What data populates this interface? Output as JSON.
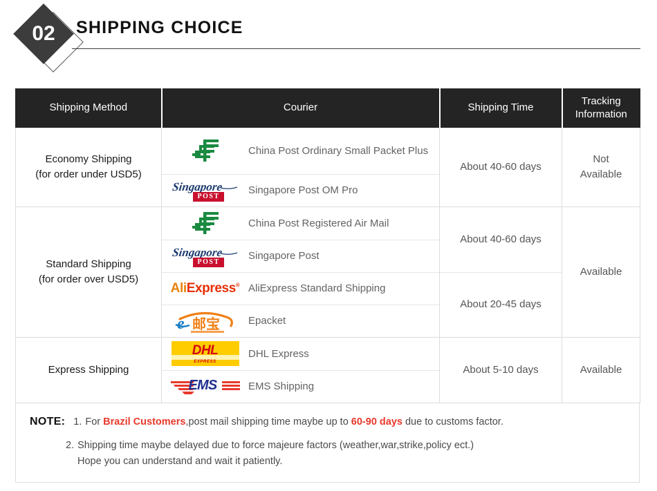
{
  "header": {
    "badge_number": "02",
    "title": "SHIPPING CHOICE"
  },
  "table": {
    "columns": {
      "method": "Shipping Method",
      "courier": "Courier",
      "time": "Shipping Time",
      "tracking_line1": "Tracking",
      "tracking_line2": "Information"
    },
    "groups": [
      {
        "method_line1": "Economy Shipping",
        "method_line2": "(for order under USD5)",
        "tracking_line1": "Not",
        "tracking_line2": "Available",
        "time_blocks": [
          {
            "label": "About 40-60 days",
            "rows": 2
          }
        ],
        "couriers": [
          {
            "logo": "china-post-logo",
            "name": "China Post Ordinary Small Packet Plus"
          },
          {
            "logo": "singapore-post-logo",
            "name": "Singapore Post OM Pro"
          }
        ]
      },
      {
        "method_line1": "Standard Shipping",
        "method_line2": "(for order over USD5)",
        "tracking_line1": "Available",
        "tracking_line2": "",
        "time_blocks": [
          {
            "label": "About 40-60 days",
            "rows": 2
          },
          {
            "label": "About 20-45 days",
            "rows": 2
          }
        ],
        "couriers": [
          {
            "logo": "china-post-logo",
            "name": "China Post Registered Air Mail"
          },
          {
            "logo": "singapore-post-logo",
            "name": "Singapore Post"
          },
          {
            "logo": "aliexpress-logo",
            "name": "AliExpress Standard Shipping"
          },
          {
            "logo": "epacket-logo",
            "name": "Epacket"
          }
        ]
      },
      {
        "method_line1": "Express Shipping",
        "method_line2": "",
        "tracking_line1": "Available",
        "tracking_line2": "",
        "time_blocks": [
          {
            "label": "About 5-10 days",
            "rows": 2
          }
        ],
        "couriers": [
          {
            "logo": "dhl-logo",
            "name": "DHL Express"
          },
          {
            "logo": "ems-logo",
            "name": "EMS Shipping"
          }
        ]
      }
    ]
  },
  "logos": {
    "singapore_post_script": "Singapore",
    "singapore_post_box": "POST",
    "aliexpress_ali": "Ali",
    "aliexpress_express": "Express",
    "aliexpress_tm": "®",
    "epacket_chars": "邮宝",
    "epacket_e": "e",
    "dhl_text": "DHL",
    "dhl_sub": "EXPRESS",
    "ems_text": "EMS"
  },
  "note": {
    "label": "NOTE:",
    "item1_num": "1.",
    "item1_part1": "For ",
    "item1_highlight1": "Brazil Customers",
    "item1_part2": ",post mail shipping time maybe up to ",
    "item1_highlight2": "60-90 days",
    "item1_part3": " due to customs factor.",
    "item2_num": "2.",
    "item2_line1": "Shipping time maybe delayed due to force majeure factors (weather,war,strike,policy ect.)",
    "item2_line2": "Hope you can understand and wait it patiently."
  },
  "colors": {
    "header_dark": "#242424",
    "badge_dark": "#3c3c3c",
    "china_post_green": "#1a8a40",
    "singapore_navy": "#1c3b6e",
    "singapore_red": "#c8102e",
    "ali_orange": "#e8820c",
    "ali_red": "#e62e04",
    "epacket_blue": "#1b7fc4",
    "epacket_orange": "#f08016",
    "dhl_yellow": "#ffcc00",
    "dhl_red": "#d40511",
    "ems_blue": "#1f2f8f",
    "ems_red": "#e8392c",
    "note_red": "#e8392c"
  }
}
